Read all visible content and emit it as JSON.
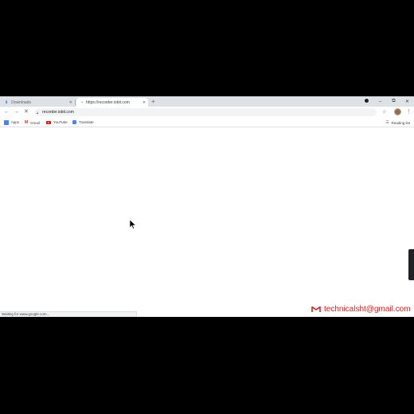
{
  "tabs": [
    {
      "title": "Downloads",
      "active": false,
      "icon": "download-icon"
    },
    {
      "title": "https://recorder.iobit.com",
      "active": true,
      "icon": "loading-icon"
    }
  ],
  "new_tab_symbol": "+",
  "window_controls": {
    "minimize": "–",
    "maximize": "⧉",
    "close": "✕"
  },
  "toolbar": {
    "back": "←",
    "forward": "→",
    "reload": "✕",
    "address": "recorder.iobit.com",
    "star": "☆",
    "menu": "⋮"
  },
  "bookmarks": [
    {
      "label": "Apps",
      "icon": "apps-grid-icon"
    },
    {
      "label": "Gmail",
      "icon": "gmail-icon"
    },
    {
      "label": "YouTube",
      "icon": "youtube-icon"
    },
    {
      "label": "Translate",
      "icon": "translate-icon"
    }
  ],
  "reading_list": "Reading list",
  "status_text": "Waiting for www.google.com...",
  "watermark": "technicalsht@gmail.com",
  "colors": {
    "watermark": "#d62020",
    "tabstrip": "#dee1e6",
    "accent": "#4285f4"
  }
}
